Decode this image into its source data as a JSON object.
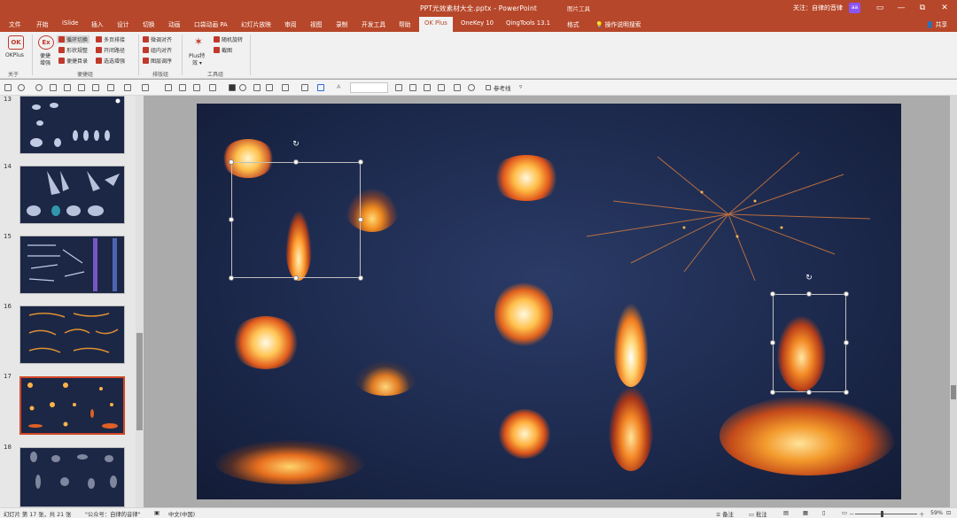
{
  "window": {
    "title": "PPT光效素材大全.pptx  -  PowerPoint",
    "context_tools": "图片工具",
    "user_label": "关注：自律的音律",
    "avatar_text": "aa",
    "min": "—",
    "restore": "⧉",
    "close": "✕",
    "ribbon_toggle": "▭"
  },
  "tabs": [
    "文件",
    "开始",
    "iSlide",
    "插入",
    "设计",
    "切换",
    "动画",
    "口袋动画 PA",
    "幻灯片放映",
    "审阅",
    "视图",
    "录制",
    "开发工具",
    "帮助",
    "OK Plus",
    "OneKey 10",
    "QingTools 13.1",
    "格式"
  ],
  "active_tab": "OK Plus",
  "search_label": "操作说明搜索",
  "share_label": "共享",
  "ribbon": {
    "okplus": "OKPlus",
    "group_guan": "关于",
    "ex_big_1": "便捷",
    "ex_big_2": "增强",
    "b1": "循环切换",
    "b2": "形状规整",
    "b3": "便捷目录",
    "b4": "多页排接",
    "b5": "开闭路径",
    "b6": "选选增强",
    "group_bianjie": "便捷组",
    "c1": "微调对齐",
    "c2": "组内对齐",
    "c3": "图层调序",
    "group_paiban": "排版组",
    "plus_big_1": "Plus特",
    "plus_big_2": "效 ▾",
    "d1": "随机旋转",
    "d2": "截图",
    "group_gongju": "工具组"
  },
  "qat": {
    "ref_line": "参考线",
    "font_a": "A"
  },
  "slides": [
    {
      "num": "13",
      "selected": false
    },
    {
      "num": "14",
      "selected": false
    },
    {
      "num": "15",
      "selected": false
    },
    {
      "num": "16",
      "selected": false
    },
    {
      "num": "17",
      "selected": true
    },
    {
      "num": "18",
      "selected": false
    }
  ],
  "status": {
    "slide_info": "幻灯片 第 17 张，共 21 张",
    "wechat": "\"公众号：自律的音律\"",
    "language": "中文(中国)",
    "notes": "备注",
    "comments": "批注",
    "zoom": "59%",
    "minus": "－",
    "plus": "＋"
  },
  "colors": {
    "title_red": "#b7472a",
    "selected_outline": "#d24726"
  }
}
